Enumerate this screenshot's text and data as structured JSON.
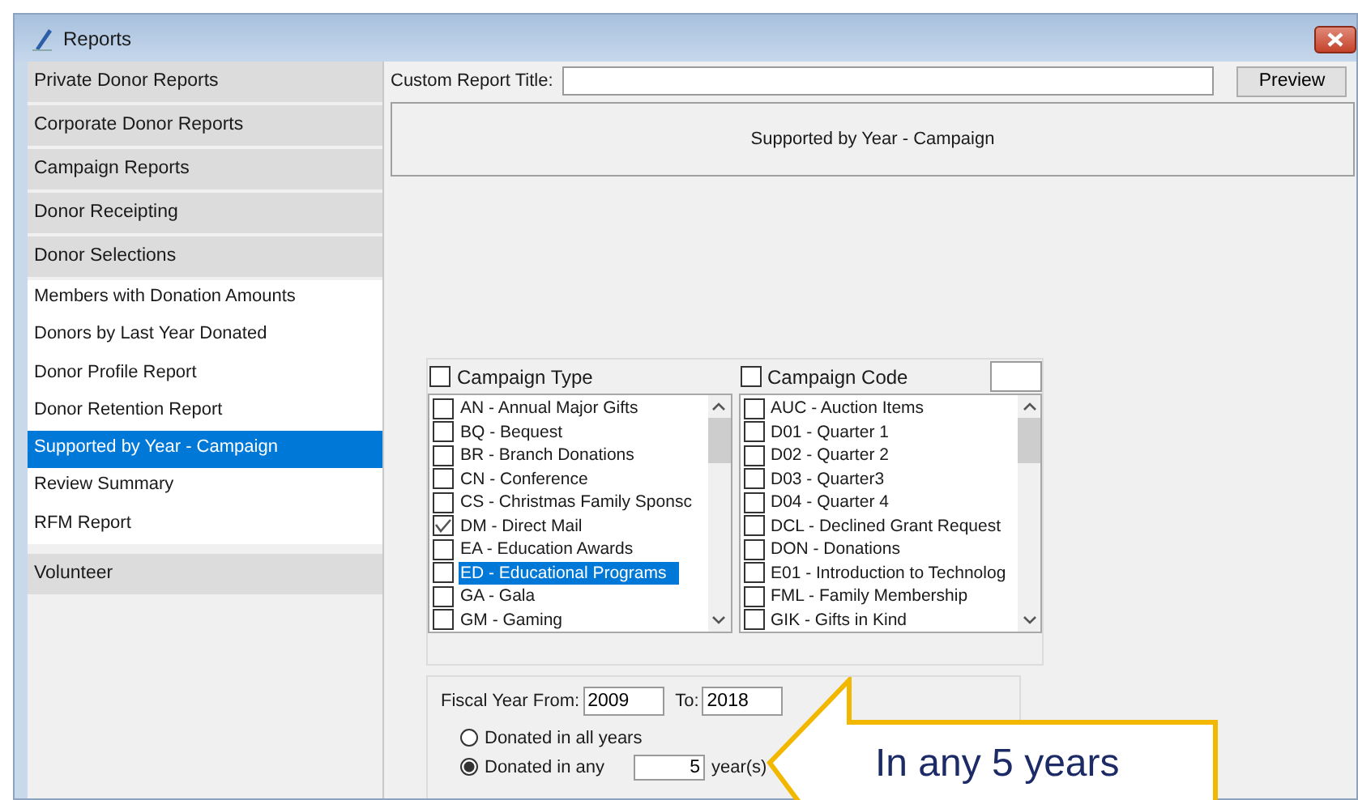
{
  "window": {
    "title": "Reports"
  },
  "sidebar": [
    {
      "label": "Private Donor Reports",
      "kind": "header",
      "selected": false
    },
    {
      "label": "Corporate Donor Reports",
      "kind": "header",
      "selected": false
    },
    {
      "label": "Campaign Reports",
      "kind": "header",
      "selected": false
    },
    {
      "label": "Donor Receipting",
      "kind": "header",
      "selected": false
    },
    {
      "label": "Donor Selections",
      "kind": "header",
      "selected": false
    },
    {
      "label": "Members with Donation Amounts",
      "kind": "item",
      "selected": false
    },
    {
      "label": "Donors by Last Year Donated",
      "kind": "item",
      "selected": false
    },
    {
      "label": "Donor Profile Report",
      "kind": "item",
      "selected": false
    },
    {
      "label": "Donor Retention Report",
      "kind": "item",
      "selected": false
    },
    {
      "label": "Supported by Year - Campaign",
      "kind": "item",
      "selected": true
    },
    {
      "label": "Review Summary",
      "kind": "item",
      "selected": false
    },
    {
      "label": "RFM Report",
      "kind": "item",
      "selected": false
    },
    {
      "label": "Volunteer",
      "kind": "header",
      "selected": false
    }
  ],
  "custom_title": {
    "label": "Custom Report Title:"
  },
  "preview_button": "Preview",
  "report_title": "Supported by Year - Campaign",
  "lists": [
    {
      "label": "Campaign Type",
      "checked": false,
      "items": [
        {
          "label": "AN - Annual Major Gifts",
          "checked": false,
          "selected": false
        },
        {
          "label": "BQ - Bequest",
          "checked": false,
          "selected": false
        },
        {
          "label": "BR - Branch Donations",
          "checked": false,
          "selected": false
        },
        {
          "label": "CN - Conference",
          "checked": false,
          "selected": false
        },
        {
          "label": "CS - Christmas Family Sponsc",
          "checked": false,
          "selected": false
        },
        {
          "label": "DM - Direct Mail",
          "checked": true,
          "selected": false
        },
        {
          "label": "EA - Education Awards",
          "checked": false,
          "selected": false
        },
        {
          "label": "ED - Educational Programs",
          "checked": false,
          "selected": true
        },
        {
          "label": "GA - Gala",
          "checked": false,
          "selected": false
        },
        {
          "label": "GM - Gaming",
          "checked": false,
          "selected": false
        }
      ]
    },
    {
      "label": "Campaign Code",
      "checked": false,
      "items": [
        {
          "label": "AUC - Auction Items",
          "checked": false,
          "selected": false
        },
        {
          "label": "D01 - Quarter 1",
          "checked": false,
          "selected": false
        },
        {
          "label": "D02 - Quarter 2",
          "checked": false,
          "selected": false
        },
        {
          "label": "D03 - Quarter3",
          "checked": false,
          "selected": false
        },
        {
          "label": "D04 - Quarter 4",
          "checked": false,
          "selected": false
        },
        {
          "label": "DCL - Declined Grant Request",
          "checked": false,
          "selected": false
        },
        {
          "label": "DON - Donations",
          "checked": false,
          "selected": false
        },
        {
          "label": "E01 - Introduction to Technolog",
          "checked": false,
          "selected": false
        },
        {
          "label": "FML - Family Membership",
          "checked": false,
          "selected": false
        },
        {
          "label": "GIK - Gifts in Kind",
          "checked": false,
          "selected": false
        }
      ]
    }
  ],
  "fiscal": {
    "from_label": "Fiscal Year From:",
    "from": "2009",
    "to_label": "To:",
    "to": "2018",
    "options": [
      {
        "label": "Donated in all years",
        "selected": false
      },
      {
        "label": "Donated in any",
        "selected": true
      }
    ],
    "any_years": "5",
    "years_suffix": "year(s)"
  },
  "callout": {
    "text": "In any 5 years"
  }
}
